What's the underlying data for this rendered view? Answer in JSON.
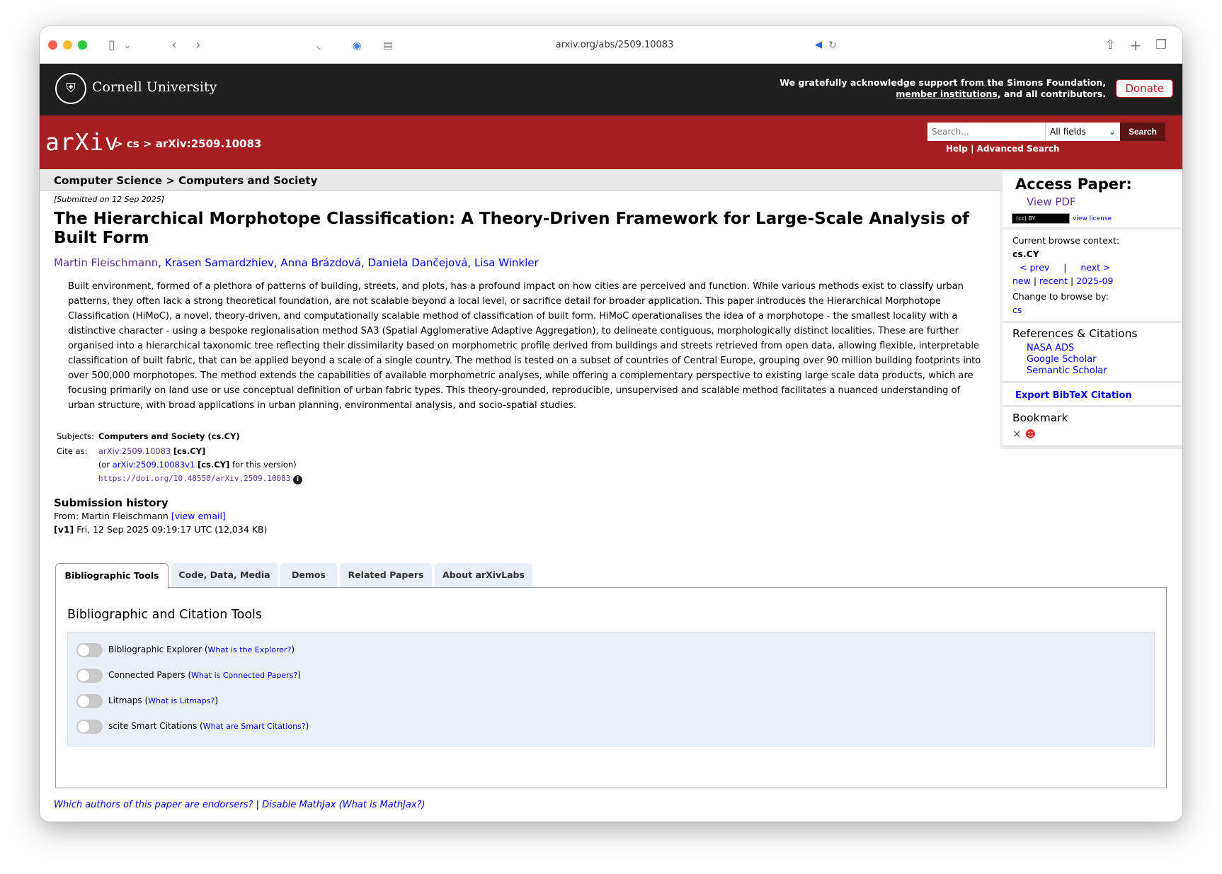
{
  "browser": {
    "url": "arxiv.org/abs/2509.10083"
  },
  "cornell": {
    "name": "Cornell University",
    "ack_line1": "We gratefully acknowledge support from the Simons Foundation,",
    "ack_link": "member institutions",
    "ack_line2_rest": ", and all contributors.",
    "donate": "Donate"
  },
  "header": {
    "logo": "arXiv",
    "crumb_sep": ">",
    "crumb_cs": "cs",
    "crumb_id": "arXiv:2509.10083",
    "search_placeholder": "Search...",
    "field_select": "All fields",
    "search_button": "Search",
    "help": "Help",
    "pipe": "|",
    "advanced": "Advanced Search"
  },
  "subhead": "Computer Science > Computers and Society",
  "paper": {
    "dateline": "[Submitted on 12 Sep 2025]",
    "title": "The Hierarchical Morphotope Classification: A Theory-Driven Framework for Large-Scale Analysis of Built Form",
    "authors": [
      "Martin Fleischmann",
      "Krasen Samardzhiev",
      "Anna Brázdová",
      "Daniela Dančejová",
      "Lisa Winkler"
    ],
    "abstract": "Built environment, formed of a plethora of patterns of building, streets, and plots, has a profound impact on how cities are perceived and function. While various methods exist to classify urban patterns, they often lack a strong theoretical foundation, are not scalable beyond a local level, or sacrifice detail for broader application. This paper introduces the Hierarchical Morphotope Classification (HiMoC), a novel, theory-driven, and computationally scalable method of classification of built form. HiMoC operationalises the idea of a morphotope - the smallest locality with a distinctive character - using a bespoke regionalisation method SA3 (Spatial Agglomerative Adaptive Aggregation), to delineate contiguous, morphologically distinct localities. These are further organised into a hierarchical taxonomic tree reflecting their dissimilarity based on morphometric profile derived from buildings and streets retrieved from open data, allowing flexible, interpretable classification of built fabric, that can be applied beyond a scale of a single country. The method is tested on a subset of countries of Central Europe, grouping over 90 million building footprints into over 500,000 morphotopes. The method extends the capabilities of available morphometric analyses, while offering a complementary perspective to existing large scale data products, which are focusing primarily on land use or use conceptual definition of urban fabric types. This theory-grounded, reproducible, unsupervised and scalable method facilitates a nuanced understanding of urban structure, with broad applications in urban planning, environmental analysis, and socio-spatial studies.",
    "subjects_label": "Subjects:",
    "subjects": "Computers and Society (cs.CY)",
    "cite_label": "Cite as:",
    "cite_id": "arXiv:2509.10083",
    "cite_cat": "[cs.CY]",
    "or_prefix": "(or",
    "cite_v1": "arXiv:2509.10083v1",
    "or_suffix": "for this version)",
    "doi": "https://doi.org/10.48550/arXiv.2509.10083"
  },
  "history": {
    "title": "Submission history",
    "from": "From: Martin Fleischmann",
    "view_email": "[view email]",
    "v1": "[v1]",
    "v1_text": "Fri, 12 Sep 2025 09:19:17 UTC (12,034 KB)"
  },
  "tabs": [
    "Bibliographic Tools",
    "Code, Data, Media",
    "Demos",
    "Related Papers",
    "About arXivLabs"
  ],
  "panel": {
    "title": "Bibliographic and Citation Tools",
    "tools": [
      {
        "label": "Bibliographic Explorer",
        "link": "What is the Explorer?"
      },
      {
        "label": "Connected Papers",
        "link": "What is Connected Papers?"
      },
      {
        "label": "Litmaps",
        "link": "What is Litmaps?"
      },
      {
        "label": "scite Smart Citations",
        "link": "What are Smart Citations?"
      }
    ]
  },
  "footer": {
    "endorsers": "Which authors of this paper are endorsers?",
    "sep": "|",
    "mathjax": "Disable MathJax",
    "what_mathjax": "(What is MathJax?)"
  },
  "sidebar": {
    "access": "Access Paper:",
    "view_pdf": "View PDF",
    "license_badge": "(cc) BY",
    "view_license": "view license",
    "context_label": "Current browse context:",
    "context": "cs.CY",
    "prev": "< prev",
    "pipe": "|",
    "next": "next >",
    "new": "new",
    "recent": "recent",
    "month": "2025-09",
    "change": "Change to browse by:",
    "cs": "cs",
    "refs_title": "References & Citations",
    "refs": [
      "NASA ADS",
      "Google Scholar",
      "Semantic Scholar"
    ],
    "bibtex": "Export BibTeX Citation",
    "bookmark": "Bookmark"
  }
}
